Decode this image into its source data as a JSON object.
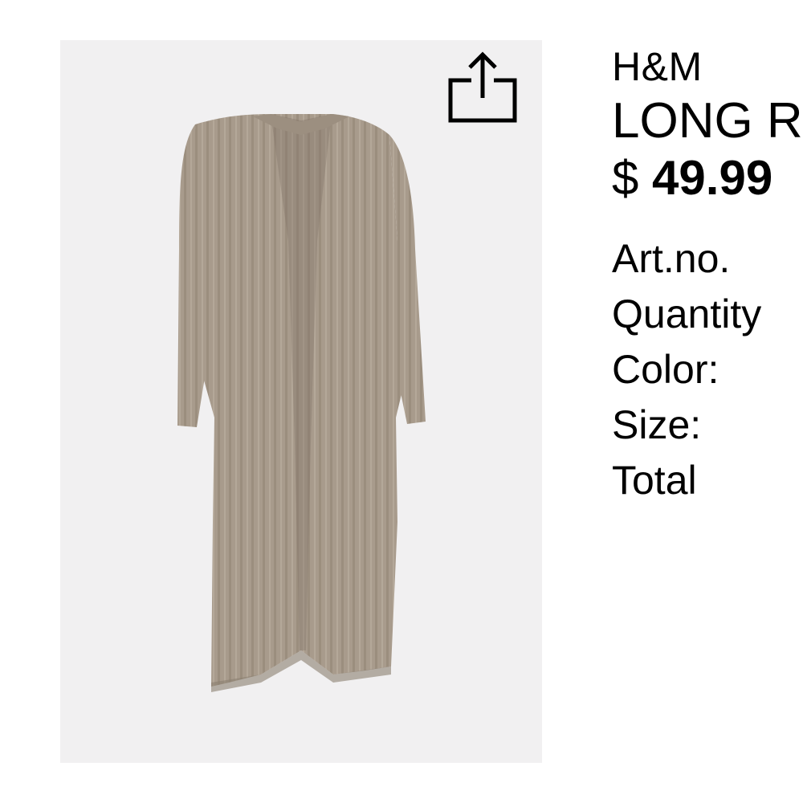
{
  "product": {
    "brand": "H&M",
    "title": "LONG RIB-KNIT CARDIGAN",
    "price_currency": "$",
    "price_amount": "49.99",
    "image_background": "#f1f0f1",
    "garment_color": "#a89b8c"
  },
  "actions": {
    "share_icon": "share-icon"
  },
  "details": [
    {
      "label": "Art.no."
    },
    {
      "label": "Quantity"
    },
    {
      "label": "Color:"
    },
    {
      "label": "Size:"
    },
    {
      "label": "Total"
    }
  ]
}
